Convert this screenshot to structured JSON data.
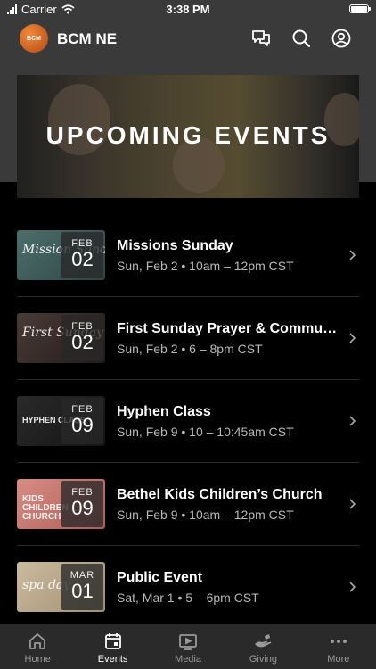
{
  "status": {
    "carrier": "Carrier",
    "time": "3:38 PM"
  },
  "header": {
    "logo_text": "BCM",
    "title": "BCM NE",
    "icons": [
      "chat-icon",
      "search-icon",
      "account-icon"
    ]
  },
  "hero": {
    "title": "UPCOMING EVENTS"
  },
  "events": [
    {
      "title": "Missions Sunday",
      "when": "Sun, Feb 2 • 10am – 12pm CST",
      "month": "FEB",
      "day": "02",
      "thumb_text": "Mission Sund",
      "thumb_bg": "#3d5d5c"
    },
    {
      "title": "First Sunday Prayer & Commu…",
      "when": "Sun, Feb 2 • 6 – 8pm CST",
      "month": "FEB",
      "day": "02",
      "thumb_text": "First Sunday prayer & comm",
      "thumb_bg": "#3b2f2c"
    },
    {
      "title": "Hyphen Class",
      "when": "Sun, Feb 9 • 10 – 10:45am CST",
      "month": "FEB",
      "day": "09",
      "thumb_text": "HYPHEN CLASS",
      "thumb_bg": "#1d1d1d"
    },
    {
      "title": "Bethel Kids Children’s Church",
      "when": "Sun, Feb 9 • 10am – 12pm CST",
      "month": "FEB",
      "day": "09",
      "thumb_text": "KIDS CHILDREN CHURCH",
      "thumb_bg": "#c7786f"
    },
    {
      "title": "Public Event",
      "when": "Sat, Mar 1 • 5 – 6pm CST",
      "month": "MAR",
      "day": "01",
      "thumb_text": "spa day",
      "thumb_bg": "#b9a88c"
    }
  ],
  "tabs": [
    {
      "label": "Home",
      "icon": "home-icon",
      "active": false
    },
    {
      "label": "Events",
      "icon": "calendar-icon",
      "active": true
    },
    {
      "label": "Media",
      "icon": "play-icon",
      "active": false
    },
    {
      "label": "Giving",
      "icon": "giving-hand-icon",
      "active": false
    },
    {
      "label": "More",
      "icon": "more-dots-icon",
      "active": false
    }
  ]
}
